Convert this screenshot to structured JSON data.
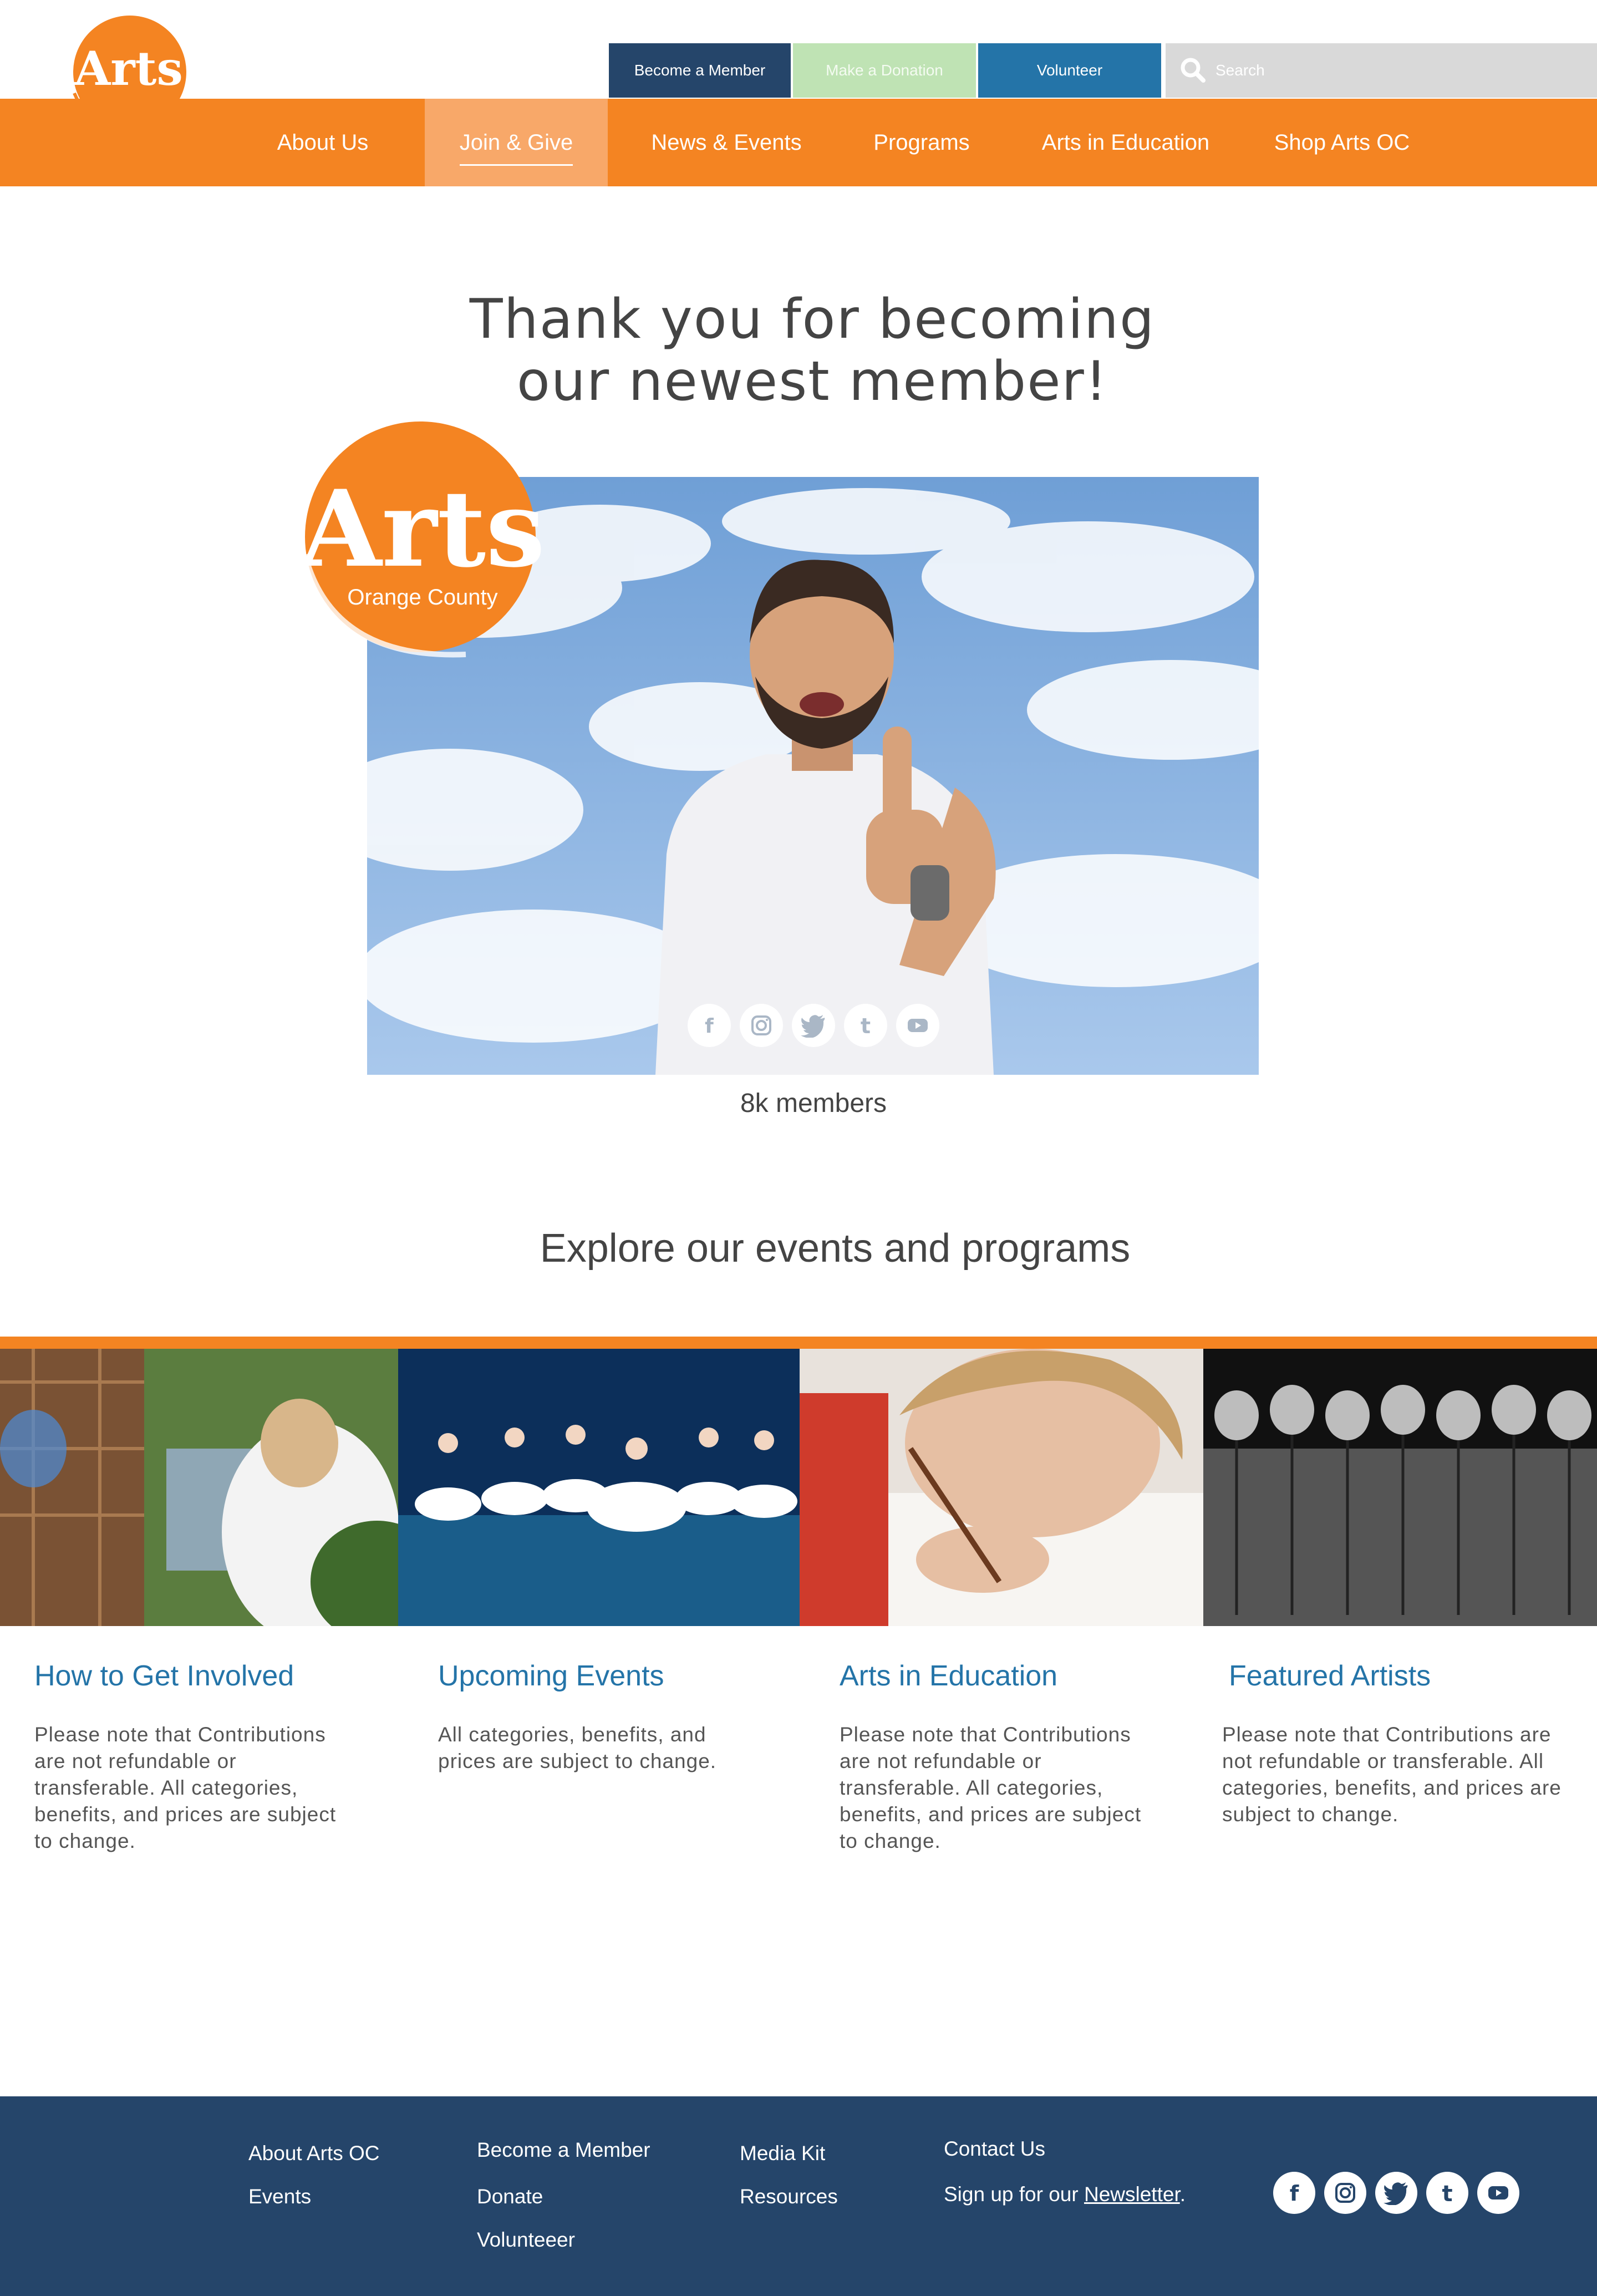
{
  "header": {
    "logo_text": "Arts",
    "logo_subtext": "Orange County",
    "actions": {
      "become_member": "Become a Member",
      "make_donation": "Make a Donation",
      "volunteer": "Volunteer"
    },
    "search": {
      "placeholder": "Search"
    }
  },
  "nav": {
    "items": [
      {
        "label": "About Us"
      },
      {
        "label": "Join & Give"
      },
      {
        "label": "News & Events"
      },
      {
        "label": "Programs"
      },
      {
        "label": "Arts in Education"
      },
      {
        "label": "Shop Arts OC"
      }
    ],
    "active_index": 1
  },
  "hero": {
    "title_line1": "Thank you for becoming",
    "title_line2": "our newest member!",
    "member_count": "8k members",
    "social_icons": [
      "facebook-icon",
      "instagram-icon",
      "twitter-icon",
      "tumblr-icon",
      "youtube-icon"
    ]
  },
  "explore": {
    "title": "Explore our events and programs",
    "cards": [
      {
        "title": "How to Get Involved",
        "text": "Please note that Contributions are not refundable or transferable. All categories, benefits, and prices are subject to change."
      },
      {
        "title": "Upcoming Events",
        "text": "All categories, benefits, and prices are subject to change."
      },
      {
        "title": "Arts in Education",
        "text": "Please note that Contributions are not refundable or transferable. All categories, benefits, and prices are subject to change."
      },
      {
        "title": "Featured Artists",
        "text": "Please note that Contributions are not refundable or transferable. All categories, benefits, and prices are subject to change."
      }
    ]
  },
  "footer": {
    "col1": [
      "About Arts OC",
      "Events"
    ],
    "col2": [
      "Become a Member",
      "Donate",
      "Volunteeer"
    ],
    "col3": [
      "Media Kit",
      "Resources"
    ],
    "contact": "Contact Us",
    "newsletter_prefix": "Sign up for our ",
    "newsletter_link": "Newsletter",
    "newsletter_suffix": "."
  },
  "colors": {
    "brand_orange": "#f48422",
    "active_nav": "#f8a869",
    "navy": "#25456a",
    "blue": "#2474a8",
    "light_green": "#bfe3b4",
    "search_gray": "#d9d9d9"
  }
}
